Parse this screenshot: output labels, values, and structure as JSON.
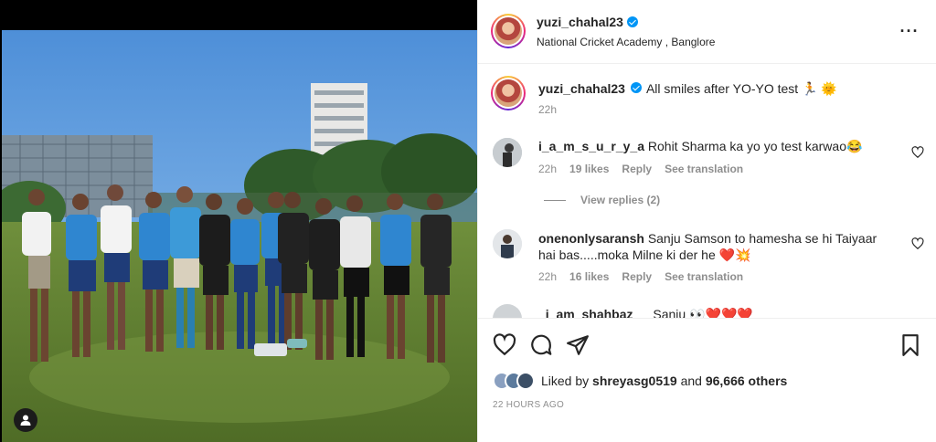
{
  "post": {
    "username": "yuzi_chahal23",
    "location": "National Cricket Academy , Banglore",
    "caption": "All smiles after YO-YO test",
    "caption_emojis": "🏃 🌞",
    "caption_time": "22h"
  },
  "comments": [
    {
      "username": "i_a_m_s_u_r_y_a",
      "text": "Rohit Sharma ka yo yo test karwao",
      "emoji": "😂",
      "time": "22h",
      "likes": "19 likes",
      "reply": "Reply",
      "translate": "See translation",
      "view_replies": "View replies (2)"
    },
    {
      "username": "onenonlysaransh",
      "text": "Sanju Samson to hamesha se hi Taiyaar hai bas.....moka Milne ki der he",
      "emoji": "❤️💥",
      "time": "22h",
      "likes": "16 likes",
      "reply": "Reply",
      "translate": "See translation"
    },
    {
      "username": "_i_am_shahbaz",
      "text": "Sanju 👀❤️❤️❤️"
    }
  ],
  "actions": {
    "liked_by_prefix": "Liked by",
    "liked_by_user": "shreyasg0519",
    "liked_by_and": "and",
    "liked_by_others": "96,666 others",
    "timestamp": "22 HOURS AGO"
  },
  "icons": {
    "like": "heart-icon",
    "comment": "comment-icon",
    "share": "send-icon",
    "save": "bookmark-icon",
    "more": "more-options-icon",
    "tag": "user-tag-icon"
  },
  "colors": {
    "verified": "#0095f6",
    "muted": "#8e8e8e",
    "text": "#262626",
    "heart": "#ed4956"
  }
}
